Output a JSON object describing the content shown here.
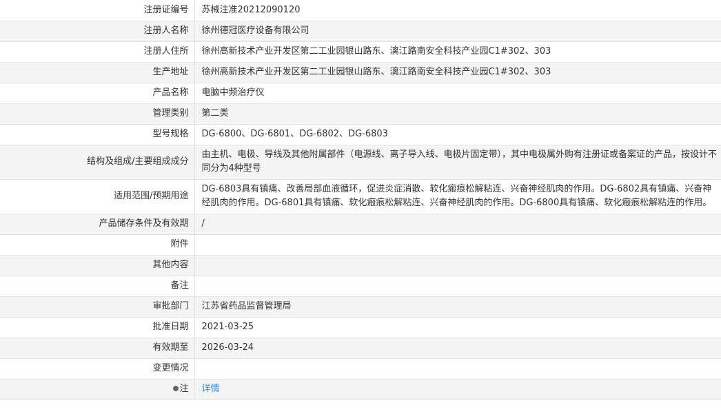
{
  "rows": [
    {
      "label": "注册证编号",
      "value": "苏械注准20212090120"
    },
    {
      "label": "注册人名称",
      "value": "徐州德冠医疗设备有限公司"
    },
    {
      "label": "注册人住所",
      "value": "徐州高新技术产业开发区第二工业园银山路东、漓江路南安全科技产业园C1#302、303"
    },
    {
      "label": "生产地址",
      "value": "徐州高新技术产业开发区第二工业园银山路东、漓江路南安全科技产业园C1#302、303"
    },
    {
      "label": "产品名称",
      "value": "电脑中频治疗仪"
    },
    {
      "label": "管理类别",
      "value": "第二类"
    },
    {
      "label": "型号规格",
      "value": "DG-6800、DG-6801、DG-6802、DG-6803"
    },
    {
      "label": "结构及组成/主要组成成分",
      "value": "由主机、电极、导线及其他附属部件（电源线、离子导入线、电极片固定带），其中电极属外购有注册证或备案证的产品，按设计不同分为4种型号"
    },
    {
      "label": "适用范围/预期用途",
      "value": "DG-6803具有镇痛、改善局部血液循环，促进炎症消散、软化瘢痕松解粘连、兴奋神经肌肉的作用。DG-6802具有镇痛、兴奋神经肌肉的作用。DG-6801具有镇痛、软化瘢痕松解粘连、兴奋神经肌肉的作用。DG-6800具有镇痛、软化瘢痕松解粘连的作用。"
    },
    {
      "label": "产品储存条件及有效期",
      "value": "/"
    },
    {
      "label": "附件",
      "value": ""
    },
    {
      "label": "其他内容",
      "value": ""
    },
    {
      "label": "备注",
      "value": ""
    },
    {
      "label": "审批部门",
      "value": "江苏省药品监督管理局"
    },
    {
      "label": "批准日期",
      "value": "2021-03-25"
    },
    {
      "label": "有效期至",
      "value": "2026-03-24"
    },
    {
      "label": "变更情况",
      "value": ""
    },
    {
      "label": "注",
      "value": "详情"
    }
  ],
  "icons": {
    "note": "bulb-icon"
  },
  "colors": {
    "link": "#2a8ae0",
    "border": "#e4e4e4",
    "stripe": "#f4f4f4"
  }
}
